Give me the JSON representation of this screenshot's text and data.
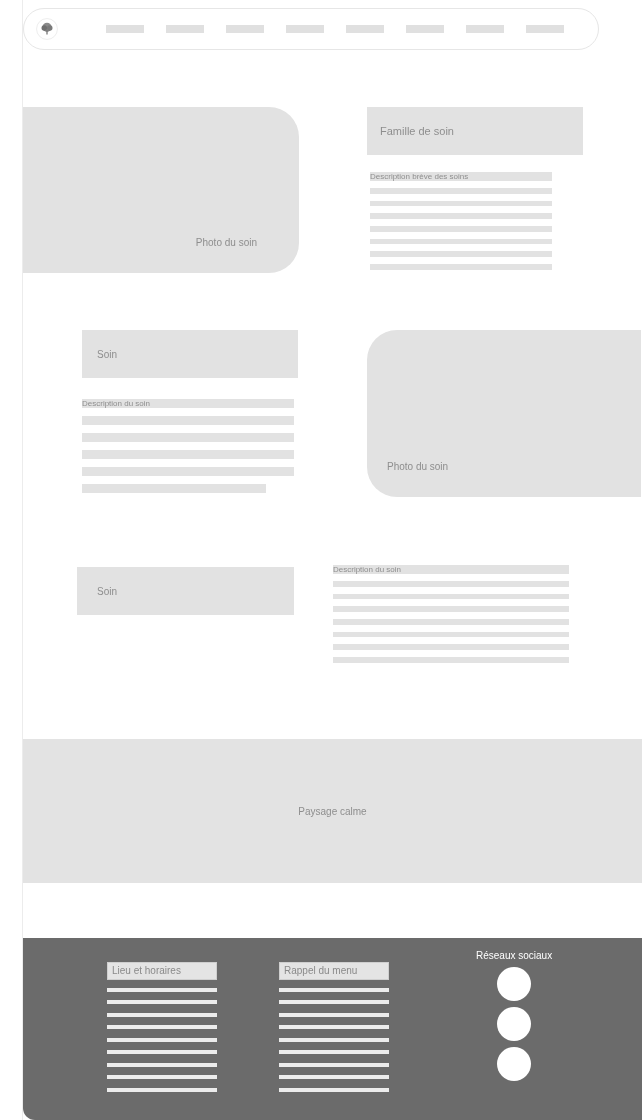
{
  "nav": {
    "logo": {
      "kind": "tree"
    },
    "items": [
      {
        "kind": "bar"
      },
      {
        "kind": "bar"
      },
      {
        "kind": "bar"
      },
      {
        "kind": "bar"
      },
      {
        "kind": "bar"
      },
      {
        "kind": "bar"
      },
      {
        "kind": "bar"
      },
      {
        "kind": "bar"
      }
    ]
  },
  "family_section": {
    "photo": {
      "label": "Photo du soin"
    },
    "title": "Famille de soin",
    "description": {
      "label": "Description brève des soins",
      "lines": [
        {
          "short": false
        },
        {
          "short": false
        },
        {
          "short": false
        },
        {
          "short": false
        },
        {
          "short": false
        },
        {
          "short": false
        },
        {
          "short": false
        }
      ]
    }
  },
  "care_sections": [
    {
      "kind": "photo",
      "title": "Soin",
      "description": {
        "label": "Description du soin",
        "lines": [
          {
            "short": false
          },
          {
            "short": false
          },
          {
            "short": false
          },
          {
            "short": false
          },
          {
            "short": true
          }
        ]
      },
      "photo": {
        "label": "Photo du soin"
      }
    },
    {
      "kind": "split",
      "title": "Soin",
      "description": {
        "label": "Description du soin",
        "lines": [
          {
            "short": false
          },
          {
            "short": false
          },
          {
            "short": false
          },
          {
            "short": false
          },
          {
            "short": false
          },
          {
            "short": false
          },
          {
            "short": false
          }
        ]
      }
    }
  ],
  "landscape": {
    "label": "Paysage calme"
  },
  "footer": {
    "columns": [
      {
        "title": "Lieu et horaires",
        "lines": [
          {
            "short": false
          },
          {
            "short": false
          },
          {
            "short": false
          },
          {
            "short": false
          },
          {
            "short": false
          },
          {
            "short": false
          },
          {
            "short": false
          },
          {
            "short": false
          },
          {
            "short": false
          }
        ]
      },
      {
        "title": "Rappel du menu",
        "lines": [
          {
            "short": false
          },
          {
            "short": false
          },
          {
            "short": false
          },
          {
            "short": false
          },
          {
            "short": false
          },
          {
            "short": false
          },
          {
            "short": false
          },
          {
            "short": false
          },
          {
            "short": false
          }
        ]
      }
    ],
    "social": {
      "title": "Réseaux sociaux",
      "links": [
        {
          "kind": "circle"
        },
        {
          "kind": "circle"
        },
        {
          "kind": "circle"
        }
      ]
    }
  }
}
